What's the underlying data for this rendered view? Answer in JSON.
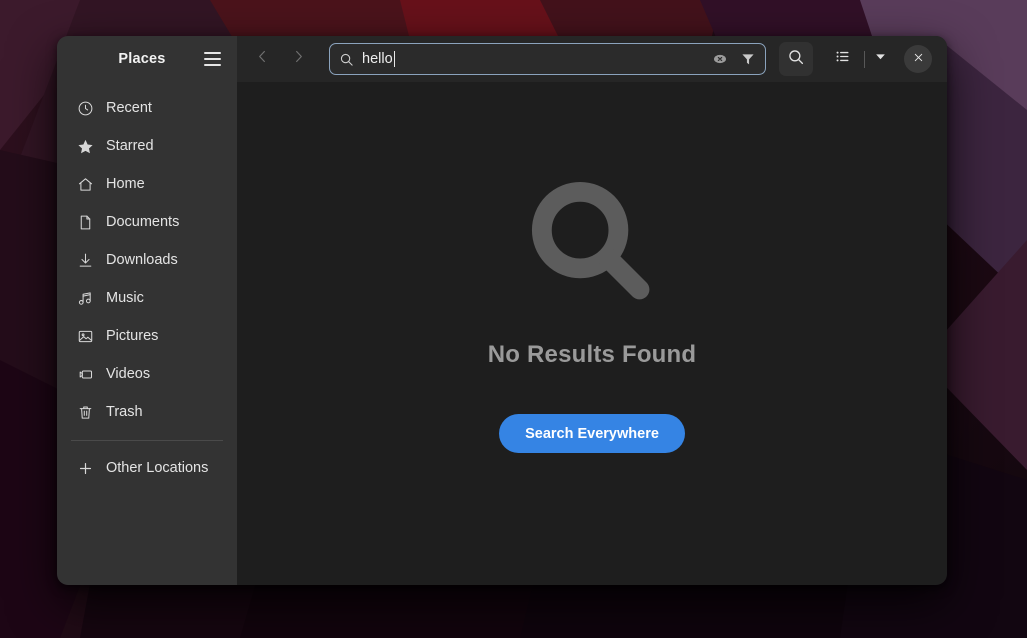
{
  "window": {
    "sidebar": {
      "title": "Places",
      "menu_icon": "hamburger-icon",
      "items": [
        {
          "label": "Recent",
          "icon": "clock-icon"
        },
        {
          "label": "Starred",
          "icon": "star-icon"
        },
        {
          "label": "Home",
          "icon": "home-icon"
        },
        {
          "label": "Documents",
          "icon": "document-icon"
        },
        {
          "label": "Downloads",
          "icon": "download-icon"
        },
        {
          "label": "Music",
          "icon": "music-note-icon"
        },
        {
          "label": "Pictures",
          "icon": "image-icon"
        },
        {
          "label": "Videos",
          "icon": "video-icon"
        },
        {
          "label": "Trash",
          "icon": "trash-icon"
        }
      ],
      "other_locations": {
        "label": "Other Locations",
        "icon": "plus-icon"
      }
    },
    "headerbar": {
      "back_icon": "chevron-left-icon",
      "forward_icon": "chevron-right-icon",
      "search": {
        "value": "hello",
        "placeholder": "Search",
        "leading_icon": "magnifier-icon",
        "clear_icon": "clear-text-icon",
        "filter_icon": "funnel-filter-icon"
      },
      "search_button_icon": "magnifier-icon",
      "view_list_icon": "list-view-icon",
      "view_dropdown_icon": "chevron-down-icon",
      "close_icon": "close-icon"
    },
    "content": {
      "empty_icon": "magnifier-icon",
      "title": "No Results Found",
      "cta_label": "Search Everywhere"
    }
  },
  "colors": {
    "accent": "#3584e4",
    "sidebar_bg": "#333333",
    "header_bg": "#262626",
    "content_bg": "#1e1e1e",
    "entry_focus_border": "#8ba3bd",
    "empty_text": "#9a9a9a"
  }
}
